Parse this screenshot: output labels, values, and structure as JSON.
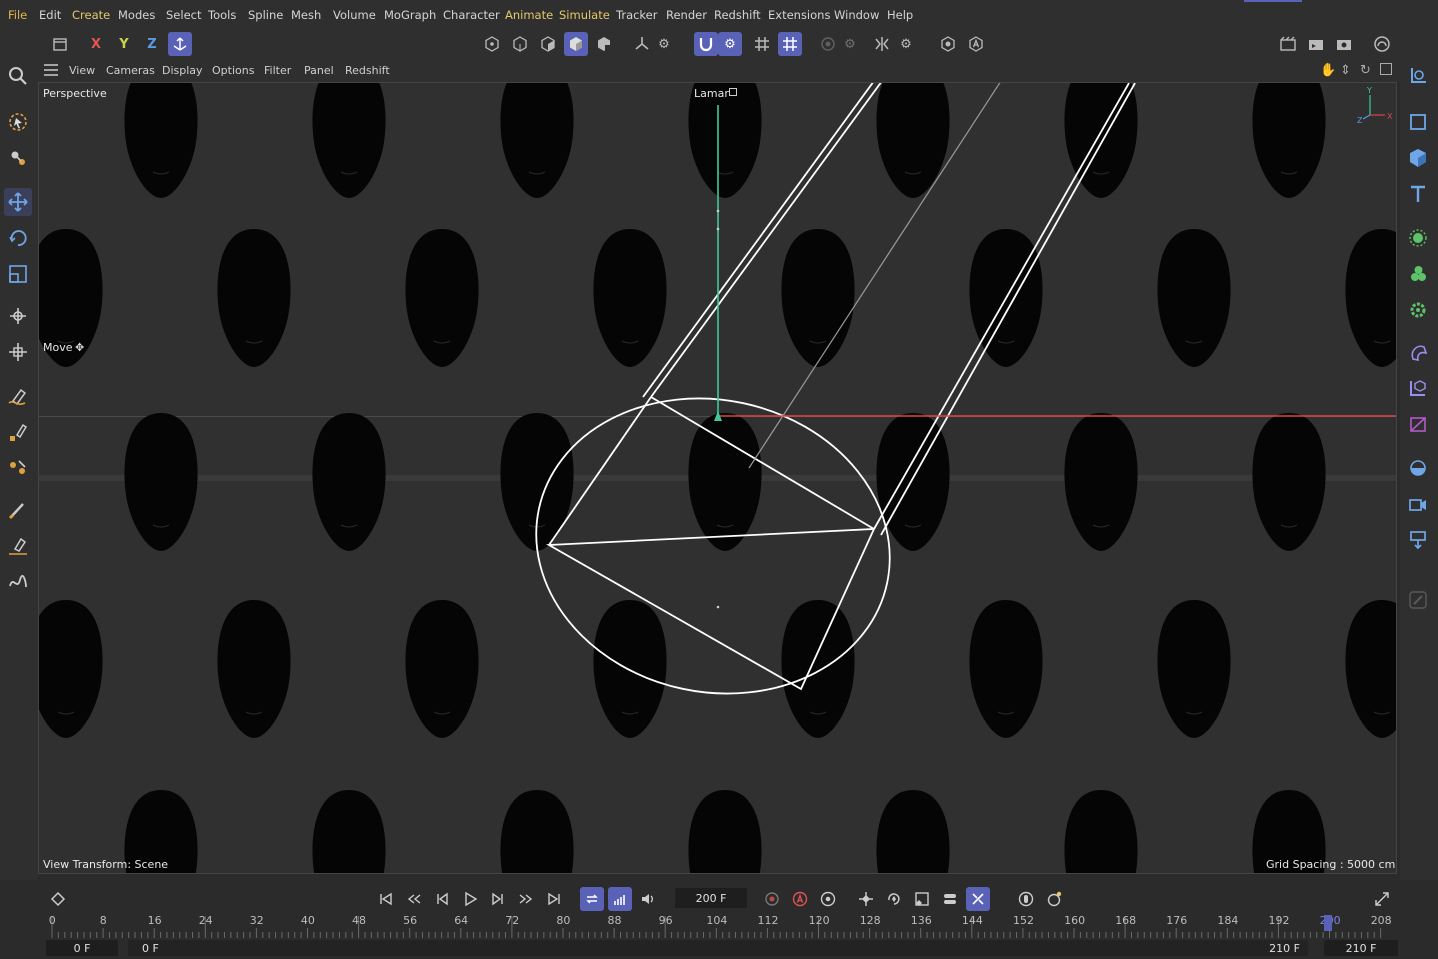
{
  "menu": [
    "File",
    "Edit",
    "Create",
    "Modes",
    "Select",
    "Tools",
    "Spline",
    "Mesh",
    "Volume",
    "MoGraph",
    "Character",
    "Animate",
    "Simulate",
    "Tracker",
    "Render",
    "Redshift",
    "Extensions",
    "Window",
    "Help"
  ],
  "toolbar": {
    "axis_x": "X",
    "axis_y": "Y",
    "axis_z": "Z"
  },
  "viewport_menu": [
    "View",
    "Cameras",
    "Display",
    "Options",
    "Filter",
    "Panel",
    "Redshift"
  ],
  "viewport": {
    "camera_name": "Perspective",
    "object_label": "Lamar",
    "tool_label": "Move",
    "view_transform": "View Transform: Scene",
    "grid_spacing": "Grid Spacing : 5000 cm"
  },
  "transport": {
    "current_frame": "200 F"
  },
  "ruler": {
    "ticks": [
      "0",
      "8",
      "16",
      "24",
      "32",
      "40",
      "48",
      "56",
      "64",
      "72",
      "80",
      "88",
      "96",
      "104",
      "112",
      "120",
      "128",
      "136",
      "144",
      "152",
      "160",
      "168",
      "176",
      "184",
      "192",
      "200",
      "208"
    ]
  },
  "range": {
    "start": "0 F",
    "min": "0 F",
    "max": "210 F",
    "end": "210 F"
  },
  "colors": {
    "accent": "#5a62b8",
    "menu_highlight": "#e4b94c",
    "x_axis": "#e05555",
    "y_axis": "#3ec9a0",
    "z_axis": "#5a9be6"
  }
}
